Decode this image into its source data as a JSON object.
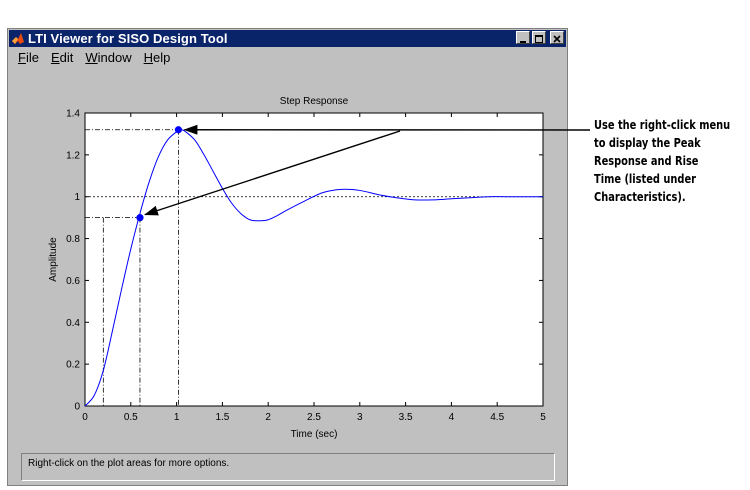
{
  "window": {
    "title": "LTI Viewer for SISO Design Tool",
    "buttons": [
      "minimize",
      "maximize",
      "close"
    ]
  },
  "menubar": {
    "items": [
      {
        "label": "File",
        "mnemonic": "F",
        "rest": "ile"
      },
      {
        "label": "Edit",
        "mnemonic": "E",
        "rest": "dit"
      },
      {
        "label": "Window",
        "mnemonic": "W",
        "rest": "indow"
      },
      {
        "label": "Help",
        "mnemonic": "H",
        "rest": "elp"
      }
    ]
  },
  "status": {
    "text": "Right-click on the plot areas for more options."
  },
  "annotation": {
    "lines": [
      "Use the right-click menu",
      "to display the Peak",
      "Response and Rise",
      "Time (listed under",
      "Characteristics)."
    ]
  },
  "chart_data": {
    "type": "line",
    "title": "Step Response",
    "xlabel": "Time (sec)",
    "ylabel": "Amplitude",
    "xlim": [
      0,
      5
    ],
    "ylim": [
      0,
      1.4
    ],
    "xticks": [
      "0",
      "0.5",
      "1",
      "1.5",
      "2",
      "2.5",
      "3",
      "3.5",
      "4",
      "4.5",
      "5"
    ],
    "yticks": [
      "0",
      "0.2",
      "0.4",
      "0.6",
      "0.8",
      "1",
      "1.2",
      "1.4"
    ],
    "steady_state": 1.0,
    "series": [
      {
        "color": "#0000ff",
        "x": [
          0,
          0.1,
          0.2,
          0.3,
          0.4,
          0.5,
          0.6,
          0.7,
          0.8,
          0.9,
          1.0,
          1.05,
          1.1,
          1.2,
          1.3,
          1.4,
          1.5,
          1.6,
          1.7,
          1.8,
          1.9,
          2.0,
          2.1,
          2.2,
          2.4,
          2.6,
          2.8,
          3.0,
          3.2,
          3.4,
          3.6,
          3.8,
          4.0,
          4.2,
          4.4,
          4.6,
          4.8,
          5.0
        ],
        "y": [
          0,
          0.05,
          0.17,
          0.36,
          0.56,
          0.75,
          0.92,
          1.07,
          1.19,
          1.27,
          1.31,
          1.32,
          1.31,
          1.27,
          1.2,
          1.12,
          1.04,
          0.97,
          0.92,
          0.89,
          0.885,
          0.89,
          0.91,
          0.935,
          0.98,
          1.02,
          1.035,
          1.03,
          1.01,
          0.995,
          0.985,
          0.985,
          0.99,
          0.995,
          1.0,
          1.0,
          1.0,
          1.0
        ]
      }
    ],
    "characteristics": {
      "peak": {
        "time": 1.02,
        "amplitude": 1.32
      },
      "rise": {
        "time_start": 0.2,
        "time_end": 0.6,
        "amplitude": 0.9
      }
    },
    "grid": false
  }
}
